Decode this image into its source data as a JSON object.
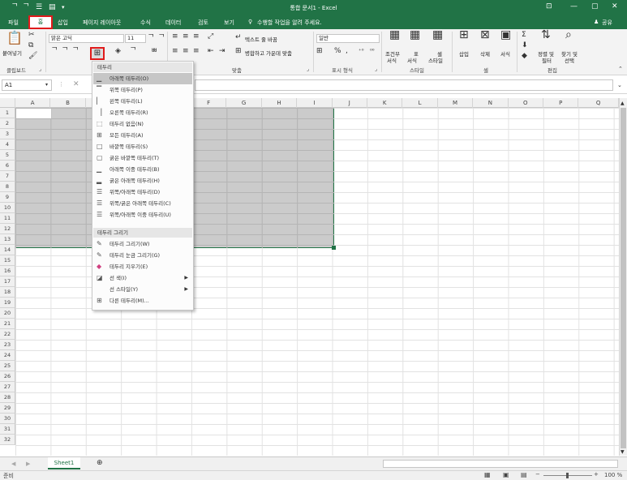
{
  "title": "통합 문서1 - Excel",
  "window_controls": {
    "ribbon_opts": "⊡",
    "minimize": "—",
    "restore": "▢",
    "close": "✕"
  },
  "tabs": [
    "파일",
    "홈",
    "삽입",
    "페이지 레이아웃",
    "수식",
    "데이터",
    "검토",
    "보기"
  ],
  "tell_me": "수행할 작업을 알려 주세요.",
  "share": "공유",
  "ribbon": {
    "paste": "붙여넣기",
    "font_name": "맑은 고딕",
    "font_size": "11",
    "wrap_text": "텍스트 줄 바꿈",
    "merge_center": "병합하고 가운데 맞춤",
    "number_format": "일반",
    "conditional": "조건부",
    "conditional2": "서식",
    "table": "표",
    "table2": "서식",
    "cell_style": "셀",
    "cell_style2": "스타일",
    "insert": "삽입",
    "delete": "삭제",
    "format": "서식",
    "sort": "정렬 및",
    "sort2": "필터",
    "find": "찾기 및",
    "find2": "선택",
    "groups": {
      "clipboard": "클립보드",
      "alignment": "맞춤",
      "number": "표시 형식",
      "styles": "스타일",
      "cells": "셀",
      "editing": "편집"
    }
  },
  "name_box": "A1",
  "columns": [
    "A",
    "B",
    "C",
    "D",
    "E",
    "F",
    "G",
    "H",
    "I",
    "J",
    "K",
    "L",
    "M",
    "N",
    "O",
    "P",
    "Q"
  ],
  "rows": [
    "1",
    "2",
    "3",
    "4",
    "5",
    "6",
    "7",
    "8",
    "9",
    "10",
    "11",
    "12",
    "13",
    "14",
    "15",
    "16",
    "17",
    "18",
    "19",
    "20",
    "21",
    "22",
    "23",
    "24",
    "25",
    "26",
    "27",
    "28",
    "29",
    "30",
    "31",
    "32"
  ],
  "menu": {
    "header1": "테두리",
    "items1": [
      {
        "label": "아래쪽 테두리(O)",
        "icon": "bottom-border-icon"
      },
      {
        "label": "위쪽 테두리(P)",
        "icon": "top-border-icon"
      },
      {
        "label": "왼쪽 테두리(L)",
        "icon": "left-border-icon"
      },
      {
        "label": "오른쪽 테두리(R)",
        "icon": "right-border-icon"
      },
      {
        "label": "테두리 없음(N)",
        "icon": "no-border-icon"
      },
      {
        "label": "모든 테두리(A)",
        "icon": "all-borders-icon"
      },
      {
        "label": "바깥쪽 테두리(S)",
        "icon": "outside-borders-icon"
      },
      {
        "label": "굵은 바깥쪽 테두리(T)",
        "icon": "thick-outside-border-icon"
      },
      {
        "label": "아래쪽 이중 테두리(B)",
        "icon": "bottom-double-border-icon"
      },
      {
        "label": "굵은 아래쪽 테두리(H)",
        "icon": "thick-bottom-border-icon"
      },
      {
        "label": "위쪽/아래쪽 테두리(D)",
        "icon": "top-bottom-border-icon"
      },
      {
        "label": "위쪽/굵은 아래쪽 테두리(C)",
        "icon": "top-thick-bottom-border-icon"
      },
      {
        "label": "위쪽/아래쪽 이중 테두리(U)",
        "icon": "top-double-bottom-border-icon"
      }
    ],
    "header2": "테두리 그리기",
    "items2": [
      {
        "label": "테두리 그리기(W)",
        "icon": "draw-border-icon"
      },
      {
        "label": "테두리 눈금 그리기(G)",
        "icon": "draw-border-grid-icon"
      },
      {
        "label": "테두리 지우기(E)",
        "icon": "erase-border-icon"
      },
      {
        "label": "선 색(I)",
        "icon": "line-color-icon"
      },
      {
        "label": "선 스타일(Y)",
        "icon": "line-style-icon"
      },
      {
        "label": "다른 테두리(M)...",
        "icon": "more-borders-icon"
      }
    ]
  },
  "sheet_tab": "Sheet1",
  "status": {
    "ready": "준비",
    "zoom": "100 %"
  },
  "colors": {
    "excel_green": "#217346",
    "highlight_red": "#e01b1b"
  }
}
